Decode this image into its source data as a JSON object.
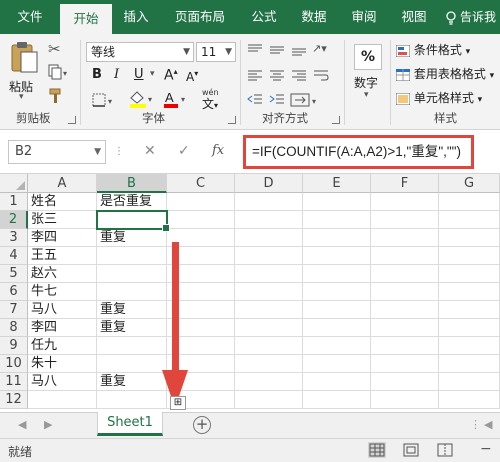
{
  "ribbon_tabs": [
    "文件",
    "开始",
    "插入",
    "页面布局",
    "公式",
    "数据",
    "审阅",
    "视图"
  ],
  "active_tab": "开始",
  "tell_me": "告诉我",
  "clipboard": {
    "paste_label": "粘贴",
    "group_label": "剪贴板"
  },
  "font": {
    "name": "等线",
    "size": "11",
    "group_label": "字体",
    "bold": "B",
    "italic": "I",
    "underline": "U",
    "grow": "A",
    "shrink": "A",
    "color_letter": "A",
    "phonetic": "wén"
  },
  "alignment": {
    "group_label": "对齐方式"
  },
  "number": {
    "percent": "%",
    "label": "数字"
  },
  "styles": {
    "items": [
      "条件格式",
      "套用表格格式",
      "单元格样式"
    ],
    "group_label": "样式"
  },
  "formula_bar": {
    "name_box": "B2",
    "fx": "fx",
    "formula": "=IF(COUNTIF(A:A,A2)>1,\"重复\",\"\")"
  },
  "grid": {
    "columns": [
      "A",
      "B",
      "C",
      "D",
      "E",
      "F",
      "G"
    ],
    "rows": [
      "1",
      "2",
      "3",
      "4",
      "5",
      "6",
      "7",
      "8",
      "9",
      "10",
      "11",
      "12"
    ],
    "column_a": [
      "姓名",
      "张三",
      "李四",
      "王五",
      "赵六",
      "牛七",
      "马八",
      "李四",
      "任九",
      "朱十",
      "马八",
      ""
    ],
    "column_b": [
      "是否重复",
      "",
      "重复",
      "",
      "",
      "",
      "重复",
      "重复",
      "",
      "",
      "重复",
      ""
    ],
    "selected_cell": "B2"
  },
  "sheet_tab": "Sheet1",
  "status": "就绪",
  "colors": {
    "excel_green": "#217346",
    "annotation_red": "#e0463b"
  }
}
